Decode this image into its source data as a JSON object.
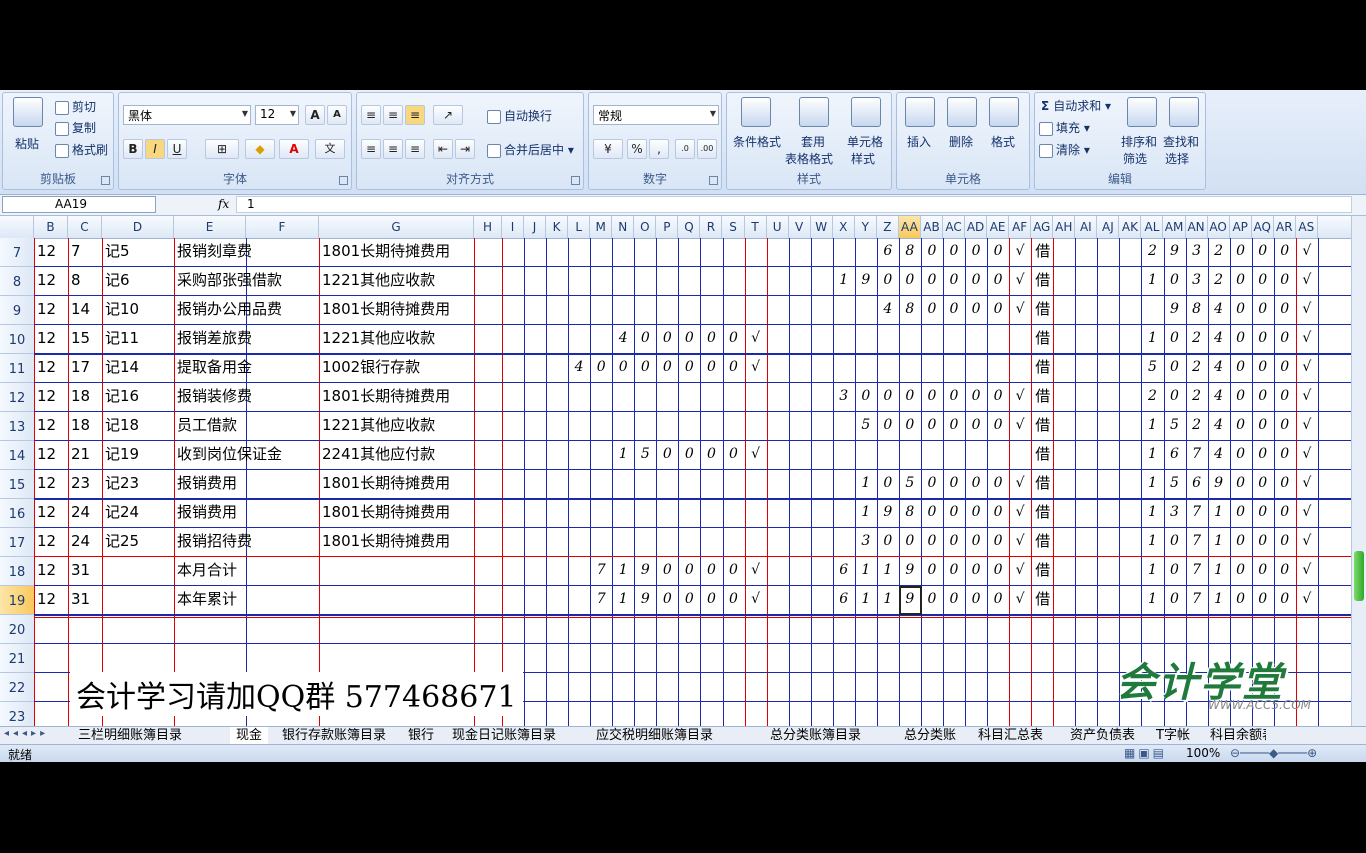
{
  "ribbon": {
    "clipboard": {
      "paste": "粘贴",
      "cut": "剪切",
      "copy": "复制",
      "format_painter": "格式刷",
      "label": "剪贴板"
    },
    "font": {
      "name": "黑体",
      "size": "12",
      "label": "字体"
    },
    "alignment": {
      "wrap": "自动换行",
      "merge": "合并后居中",
      "label": "对齐方式"
    },
    "number": {
      "format": "常规",
      "percent": "%",
      "comma": ",",
      "label": "数字"
    },
    "styles": {
      "conditional": "条件格式",
      "table_line1": "套用",
      "table_line2": "表格格式",
      "cell_line1": "单元格",
      "cell_line2": "样式",
      "label": "样式"
    },
    "cells": {
      "insert": "插入",
      "delete": "删除",
      "format": "格式",
      "label": "单元格"
    },
    "editing": {
      "autosum": "自动求和",
      "fill": "填充",
      "clear": "清除",
      "sort_line1": "排序和",
      "sort_line2": "筛选",
      "find_line1": "查找和",
      "find_line2": "选择",
      "label": "编辑"
    }
  },
  "formula_bar": {
    "name_box": "AA19",
    "fx": "fx",
    "value": "1"
  },
  "columns": [
    "B",
    "C",
    "D",
    "E",
    "F",
    "G",
    "H",
    "I",
    "J",
    "K",
    "L",
    "M",
    "N",
    "O",
    "P",
    "Q",
    "R",
    "S",
    "T",
    "U",
    "V",
    "W",
    "X",
    "Y",
    "Z",
    "AA",
    "AB",
    "AC",
    "AD",
    "AE",
    "AF",
    "AG",
    "AH",
    "AI",
    "AJ",
    "AK",
    "AL",
    "AM",
    "AN",
    "AO",
    "AP",
    "AQ",
    "AR",
    "AS"
  ],
  "selected_column": "AA",
  "rows": [
    {
      "num": "7",
      "b": "12",
      "c": "7",
      "d": "记5",
      "e": "报销刻章费",
      "g": "1801长期待摊费用",
      "debit": "",
      "debit_ck": "",
      "credit": "680000",
      "credit_ck": "√",
      "dir": "借",
      "bal": "2932000",
      "bal_ck": "√"
    },
    {
      "num": "8",
      "b": "12",
      "c": "8",
      "d": "记6",
      "e": "采购部张强借款",
      "g": "1221其他应收款",
      "debit": "",
      "debit_ck": "",
      "credit": "19000000",
      "credit_ck": "√",
      "dir": "借",
      "bal": "1032000",
      "bal_ck": "√"
    },
    {
      "num": "9",
      "b": "12",
      "c": "14",
      "d": "记10",
      "e": "报销办公用品费",
      "g": "1801长期待摊费用",
      "debit": "",
      "debit_ck": "",
      "credit": "480000",
      "credit_ck": "√",
      "dir": "借",
      "bal": "984000",
      "bal_ck": "√"
    },
    {
      "num": "10",
      "b": "12",
      "c": "15",
      "d": "记11",
      "e": "报销差旅费",
      "g": "1221其他应收款",
      "debit": "400000",
      "debit_ck": "√",
      "credit": "",
      "credit_ck": "",
      "dir": "借",
      "bal": "1024000",
      "bal_ck": "√"
    },
    {
      "num": "11",
      "b": "12",
      "c": "17",
      "d": "记14",
      "e": "提取备用金",
      "g": "1002银行存款",
      "debit": "40000000",
      "debit_ck": "√",
      "credit": "",
      "credit_ck": "",
      "dir": "借",
      "bal": "5024000",
      "bal_ck": "√"
    },
    {
      "num": "12",
      "b": "12",
      "c": "18",
      "d": "记16",
      "e": "报销装修费",
      "g": "1801长期待摊费用",
      "debit": "",
      "debit_ck": "",
      "credit": "30000000",
      "credit_ck": "√",
      "dir": "借",
      "bal": "2024000",
      "bal_ck": "√"
    },
    {
      "num": "13",
      "b": "12",
      "c": "18",
      "d": "记18",
      "e": "员工借款",
      "g": "1221其他应收款",
      "debit": "",
      "debit_ck": "",
      "credit": "5000000",
      "credit_ck": "√",
      "dir": "借",
      "bal": "1524000",
      "bal_ck": "√"
    },
    {
      "num": "14",
      "b": "12",
      "c": "21",
      "d": "记19",
      "e": "收到岗位保证金",
      "g": "2241其他应付款",
      "debit": "150000",
      "debit_ck": "√",
      "credit": "",
      "credit_ck": "",
      "dir": "借",
      "bal": "1674000",
      "bal_ck": "√"
    },
    {
      "num": "15",
      "b": "12",
      "c": "23",
      "d": "记23",
      "e": "报销费用",
      "g": "1801长期待摊费用",
      "debit": "",
      "debit_ck": "",
      "credit": "1050000",
      "credit_ck": "√",
      "dir": "借",
      "bal": "1569000",
      "bal_ck": "√"
    },
    {
      "num": "16",
      "b": "12",
      "c": "24",
      "d": "记24",
      "e": "报销费用",
      "g": "1801长期待摊费用",
      "debit": "",
      "debit_ck": "",
      "credit": "1980000",
      "credit_ck": "√",
      "dir": "借",
      "bal": "1371000",
      "bal_ck": "√"
    },
    {
      "num": "17",
      "b": "12",
      "c": "24",
      "d": "记25",
      "e": "报销招待费",
      "g": "1801长期待摊费用",
      "debit": "",
      "debit_ck": "",
      "credit": "3000000",
      "credit_ck": "√",
      "dir": "借",
      "bal": "1071000",
      "bal_ck": "√"
    },
    {
      "num": "18",
      "b": "12",
      "c": "31",
      "d": "",
      "e": "本月合计",
      "g": "",
      "debit": "7190000",
      "debit_ck": "√",
      "credit": "61190000",
      "credit_ck": "√",
      "dir": "借",
      "bal": "1071000",
      "bal_ck": "√"
    },
    {
      "num": "19",
      "b": "12",
      "c": "31",
      "d": "",
      "e": "本年累计",
      "g": "",
      "debit": "7190000",
      "debit_ck": "√",
      "credit": "61190000",
      "credit_ck": "√",
      "dir": "借",
      "bal": "1071000",
      "bal_ck": "√"
    },
    {
      "num": "20"
    },
    {
      "num": "21"
    },
    {
      "num": "22"
    },
    {
      "num": "23"
    }
  ],
  "selected_row": "19",
  "overlay_text": "会计学习请加QQ群 577468671",
  "logo": {
    "text": "会计学堂",
    "url": "WWW.ACC5.COM"
  },
  "sheet_tabs": [
    "三栏明细账簿目录",
    "现金",
    "银行存款账簿目录",
    "银行",
    "现金日记账簿目录",
    "应交税明细账簿目录",
    "总分类账簿目录",
    "总分类账",
    "科目汇总表",
    "资产负债表",
    "T字帐",
    "科目余额表"
  ],
  "active_tab": "现金",
  "status": {
    "text": "就绪",
    "zoom": "100%"
  },
  "colors": {
    "red_rule": "#e00000",
    "blue_rule": "#1a2aa8",
    "selection": "#f8c95c"
  }
}
